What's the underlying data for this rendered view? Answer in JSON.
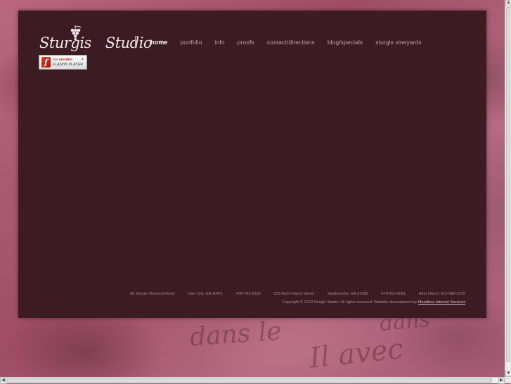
{
  "brand": {
    "logo_word1": "Sturgis",
    "logo_word2": "Studio"
  },
  "nav": {
    "items": [
      {
        "label": "home",
        "active": true
      },
      {
        "label": "portfolio",
        "active": false
      },
      {
        "label": "info",
        "active": false
      },
      {
        "label": "proofs",
        "active": false
      },
      {
        "label": "contact/directions",
        "active": false
      },
      {
        "label": "blog/specials",
        "active": false
      },
      {
        "label": "sturgis vineyards",
        "active": false
      }
    ]
  },
  "flash_badge": {
    "line1_prefix": "Get",
    "line1_brand": "ADOBE®",
    "line2": "FLASH® PLAYER"
  },
  "footer": {
    "address1": "56 Sturgis Vineyard Road",
    "city1": "Twin City, GA 30471",
    "phone1": "478-763-2518",
    "address2": "123 North Harris Street",
    "city2": "Sandersville, GA 31082",
    "phone2": "478-553-9001",
    "after_hours": "After Hours: 912-682-2379",
    "copyright": "Copyright © 2010 Sturgis Studio. All rights reserved. Website development by",
    "developer_link": "Marathon Internet Services"
  },
  "background_script": [
    "dans le",
    "Il avec",
    "dans"
  ],
  "colors": {
    "panel": "#3d1b22",
    "background": "#a8576f",
    "nav_text": "#b8a6ab",
    "nav_active": "#ffffff"
  }
}
